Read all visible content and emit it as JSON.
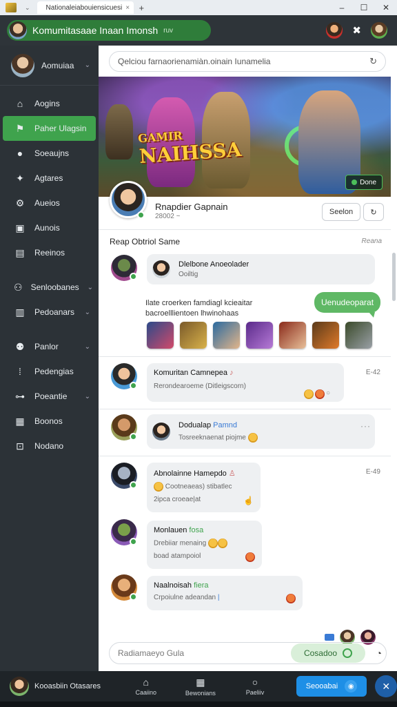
{
  "window": {
    "tab_title": "Nationaleiabouiensicuesi",
    "controls": [
      "–",
      "☐",
      "✕"
    ]
  },
  "header": {
    "title": "Komumitasaae Inaan Imonsh",
    "subtitle": "ruv"
  },
  "sidebar": {
    "user_name": "Aomuiaa",
    "items": [
      {
        "label": "Aogins",
        "icon": "home-icon"
      },
      {
        "label": "Paher Ulagsin",
        "icon": "flag-icon"
      },
      {
        "label": "Soeaujns",
        "icon": "chat-icon"
      },
      {
        "label": "Agtares",
        "icon": "bird-icon"
      },
      {
        "label": "Aueios",
        "icon": "gear-icon"
      },
      {
        "label": "Aunois",
        "icon": "calendar-icon"
      },
      {
        "label": "Reeinos",
        "icon": "document-icon"
      },
      {
        "label": "Senloobanes",
        "icon": "group-icon"
      },
      {
        "label": "Pedoanars",
        "icon": "folder-icon"
      },
      {
        "label": "Panlor",
        "icon": "people-icon"
      },
      {
        "label": "Pedengias",
        "icon": "tools-icon"
      },
      {
        "label": "Poeantie",
        "icon": "link-icon"
      },
      {
        "label": "Boonos",
        "icon": "grid-icon"
      },
      {
        "label": "Nodano",
        "icon": "terminal-icon"
      }
    ]
  },
  "main": {
    "search_placeholder": "Qelciou farnaorienamiàn.oinain Iunamelia",
    "banner": {
      "logo_top": "GAMIR",
      "logo_bottom": "NAIHSSA",
      "button_label": "Done"
    },
    "profile": {
      "name": "Rnapdier Gapnain",
      "sub": "28002 ~",
      "btn_primary": "Seelon",
      "btn_icon": "refresh-icon"
    },
    "section": {
      "title": "Reap Obtriol Same",
      "right": "Reana"
    },
    "messages": [
      {
        "name": "Dlelbone Anoeolader",
        "sub": "Ooiltig"
      },
      {
        "sent": "Uenudeoparat"
      },
      {
        "shared_line1": "Ilate croerken famdiagl kcieaitar",
        "shared_line2": "bacroelllientoen lhwinohaas"
      },
      {
        "name": "Komuritan Camnepea",
        "text": "Rerondearoeme (Ditleigscorn)",
        "time": "E-42"
      },
      {
        "name": "Dodualap",
        "tag": "Pamnd",
        "text": "Tosreeknaenat piojme"
      },
      {
        "name": "Abnolainne Hamepdo",
        "text": "Cootneaeas) stibatlec",
        "sub": "2ipca croeae|at",
        "time": "E-49"
      },
      {
        "name": "Monlauen",
        "tag": "fosa",
        "text": "Drebiiar menaing",
        "sub": "boad atampoiol"
      },
      {
        "name": "Naalnoisah",
        "tag": "fiera",
        "text": "Crpoiulne adeandan"
      }
    ],
    "composer": {
      "placeholder": "Radiamaeyo Gula",
      "send_label": "Cosadoo"
    }
  },
  "bottombar": {
    "user_name": "Kooasbiin Otasares",
    "nav": [
      {
        "label": "Caaiino",
        "icon": "home-icon"
      },
      {
        "label": "Bewonians",
        "icon": "grid-icon"
      },
      {
        "label": "Paeliiv",
        "icon": "search-icon"
      }
    ],
    "action_label": "Seooabai",
    "close_icon": "close-icon"
  }
}
